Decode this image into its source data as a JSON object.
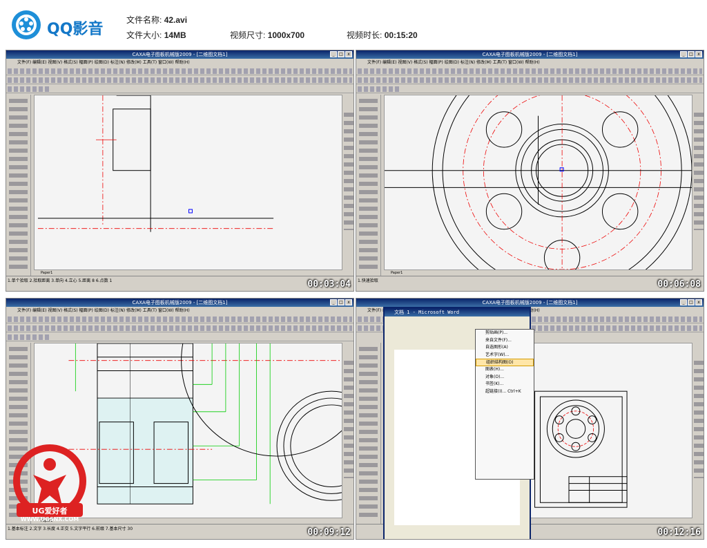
{
  "app": {
    "brand": "QQ影音"
  },
  "file_info": {
    "name_label": "文件名称:",
    "name_value": "42.avi",
    "size_label": "文件大小:",
    "size_value": "14MB",
    "dims_label": "视频尺寸:",
    "dims_value": "1000x700",
    "duration_label": "视频时长:",
    "duration_value": "00:15:20"
  },
  "thumbnails": [
    {
      "timestamp": "00:03:04",
      "window_title": "CAXA电子图板机械版2009 - [二维图文档1]",
      "status": "1.单个拾取  2.拾取距离  3.单向  4.立心  5.距离 8  6.点数 1",
      "tab": "Paper1"
    },
    {
      "timestamp": "00:06:08",
      "window_title": "CAXA电子图板机械版2009 - [二维图文档1]",
      "status": "1.快速拾取",
      "tab": "Paper1"
    },
    {
      "timestamp": "00:09:12",
      "window_title": "CAXA电子图板机械版2009 - [二维图文档1]",
      "status": "1.基本标注  2.文字 3.长度  4.正交  5.文字平行  6.前缀  7.基本尺寸 30",
      "tab": "Paper1"
    },
    {
      "timestamp": "00:12:16",
      "window_title": "CAXA电子图板机械版2009 - [二维图文档1]",
      "status": "",
      "tab": "",
      "word_title": "文档 1 - Microsoft Word"
    }
  ],
  "cad_menu": "文件(F)  编辑(E)  视图(V)  格式(S)  幅面(P)  绘图(D)  标注(N)  修改(M)  工具(T)  窗口(W)  帮助(H)",
  "word_menu": {
    "items": [
      "剪贴画(P)...",
      "来自文件(F)...",
      "自选图形(A)",
      "艺术字(W)...",
      "组织结构图(O)",
      "图表(H)...",
      "对象(O)...",
      "书签(K)...",
      "超链接(I)...  Ctrl+K"
    ]
  },
  "watermark": {
    "text": "UG爱好者",
    "url": "WWW.UGSNX.COM"
  }
}
